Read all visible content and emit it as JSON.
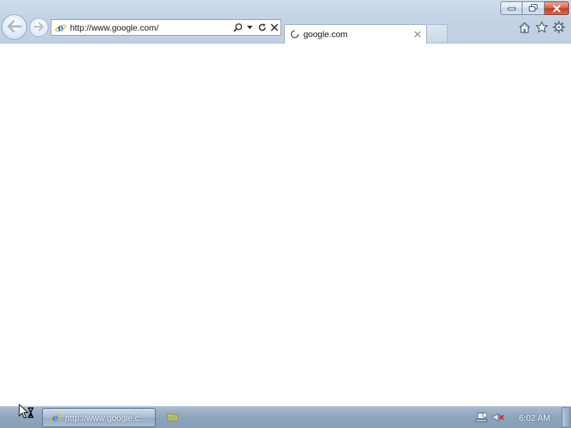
{
  "browser": {
    "address_url": "http://www.google.com/",
    "tab_title": "google.com",
    "colors": {
      "ie_blue": "#1e6fd9",
      "ie_gold": "#e8b520",
      "close_red": "#c53a22"
    }
  },
  "taskbar": {
    "browser_button_label": "http://www.google.c...",
    "clock": "6:02 AM"
  },
  "icons": {
    "back": "back-arrow-icon",
    "forward": "forward-arrow-icon",
    "site": "ie-logo-icon",
    "search": "search-icon",
    "dropdown": "chevron-down-icon",
    "refresh": "refresh-icon",
    "stop": "close-icon",
    "loading": "loading-spinner-icon",
    "home": "home-icon",
    "favorites": "star-icon",
    "tools": "gear-icon",
    "folder": "folder-icon",
    "network": "network-icon",
    "volume": "volume-muted-icon"
  }
}
